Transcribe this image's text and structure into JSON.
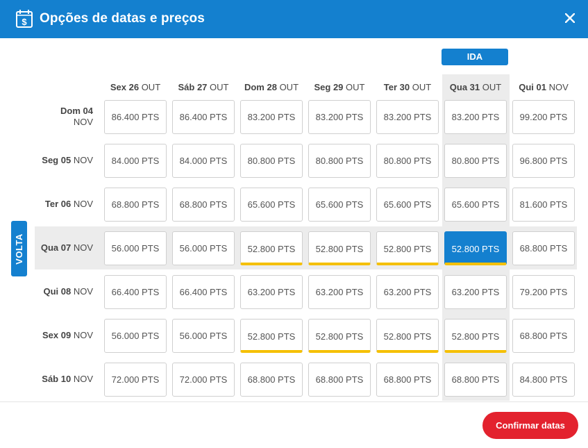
{
  "header": {
    "title": "Opções de datas e preços"
  },
  "badges": {
    "ida": "IDA",
    "volta": "VOLTA"
  },
  "columns": [
    {
      "day": "Sex 26",
      "month": "OUT"
    },
    {
      "day": "Sáb 27",
      "month": "OUT"
    },
    {
      "day": "Dom 28",
      "month": "OUT"
    },
    {
      "day": "Seg 29",
      "month": "OUT"
    },
    {
      "day": "Ter 30",
      "month": "OUT"
    },
    {
      "day": "Qua 31",
      "month": "OUT"
    },
    {
      "day": "Qui 01",
      "month": "NOV"
    }
  ],
  "rows": [
    {
      "day": "Dom 04",
      "month": "NOV",
      "prices": [
        "86.400 PTS",
        "86.400 PTS",
        "83.200 PTS",
        "83.200 PTS",
        "83.200 PTS",
        "83.200 PTS",
        "99.200 PTS"
      ]
    },
    {
      "day": "Seg 05",
      "month": "NOV",
      "prices": [
        "84.000 PTS",
        "84.000 PTS",
        "80.800 PTS",
        "80.800 PTS",
        "80.800 PTS",
        "80.800 PTS",
        "96.800 PTS"
      ]
    },
    {
      "day": "Ter 06",
      "month": "NOV",
      "prices": [
        "68.800 PTS",
        "68.800 PTS",
        "65.600 PTS",
        "65.600 PTS",
        "65.600 PTS",
        "65.600 PTS",
        "81.600 PTS"
      ]
    },
    {
      "day": "Qua 07",
      "month": "NOV",
      "prices": [
        "56.000 PTS",
        "56.000 PTS",
        "52.800 PTS",
        "52.800 PTS",
        "52.800 PTS",
        "52.800 PTS",
        "68.800 PTS"
      ]
    },
    {
      "day": "Qui 08",
      "month": "NOV",
      "prices": [
        "66.400 PTS",
        "66.400 PTS",
        "63.200 PTS",
        "63.200 PTS",
        "63.200 PTS",
        "63.200 PTS",
        "79.200 PTS"
      ]
    },
    {
      "day": "Sex 09",
      "month": "NOV",
      "prices": [
        "56.000 PTS",
        "56.000 PTS",
        "52.800 PTS",
        "52.800 PTS",
        "52.800 PTS",
        "52.800 PTS",
        "68.800 PTS"
      ]
    },
    {
      "day": "Sáb 10",
      "month": "NOV",
      "prices": [
        "72.000 PTS",
        "72.000 PTS",
        "68.800 PTS",
        "68.800 PTS",
        "68.800 PTS",
        "68.800 PTS",
        "84.800 PTS"
      ]
    }
  ],
  "selection": {
    "column_index": 5,
    "row_index": 3
  },
  "cheapest_price": "52.800 PTS",
  "footer": {
    "confirm_label": "Confirmar datas"
  },
  "colors": {
    "primary": "#1480cf",
    "cheapest_underline": "#f5c000",
    "confirm": "#e3222e",
    "highlight": "#ececec"
  },
  "icons": {
    "header": "calendar-dollar-icon",
    "close": "close-icon"
  }
}
